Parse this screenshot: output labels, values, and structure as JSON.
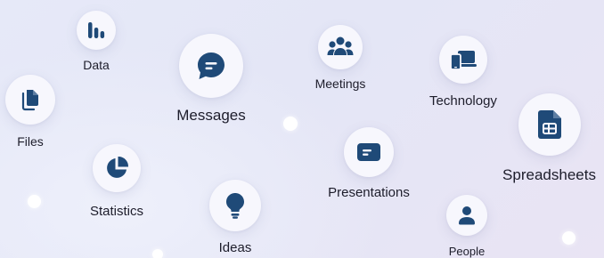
{
  "colors": {
    "icon": "#1f4a78",
    "bubble": "#f7f7fd",
    "label": "#1d1d2b"
  },
  "nodes": {
    "data": {
      "label": "Data",
      "icon": "bar-chart-icon"
    },
    "files": {
      "label": "Files",
      "icon": "files-icon"
    },
    "messages": {
      "label": "Messages",
      "icon": "chat-bubble-icon"
    },
    "meetings": {
      "label": "Meetings",
      "icon": "group-icon"
    },
    "technology": {
      "label": "Technology",
      "icon": "devices-icon"
    },
    "spreadsheets": {
      "label": "Spreadsheets",
      "icon": "spreadsheet-icon"
    },
    "statistics": {
      "label": "Statistics",
      "icon": "pie-chart-icon"
    },
    "ideas": {
      "label": "Ideas",
      "icon": "lightbulb-icon"
    },
    "presentations": {
      "label": "Presentations",
      "icon": "presentation-icon"
    },
    "people": {
      "label": "People",
      "icon": "person-icon"
    }
  }
}
